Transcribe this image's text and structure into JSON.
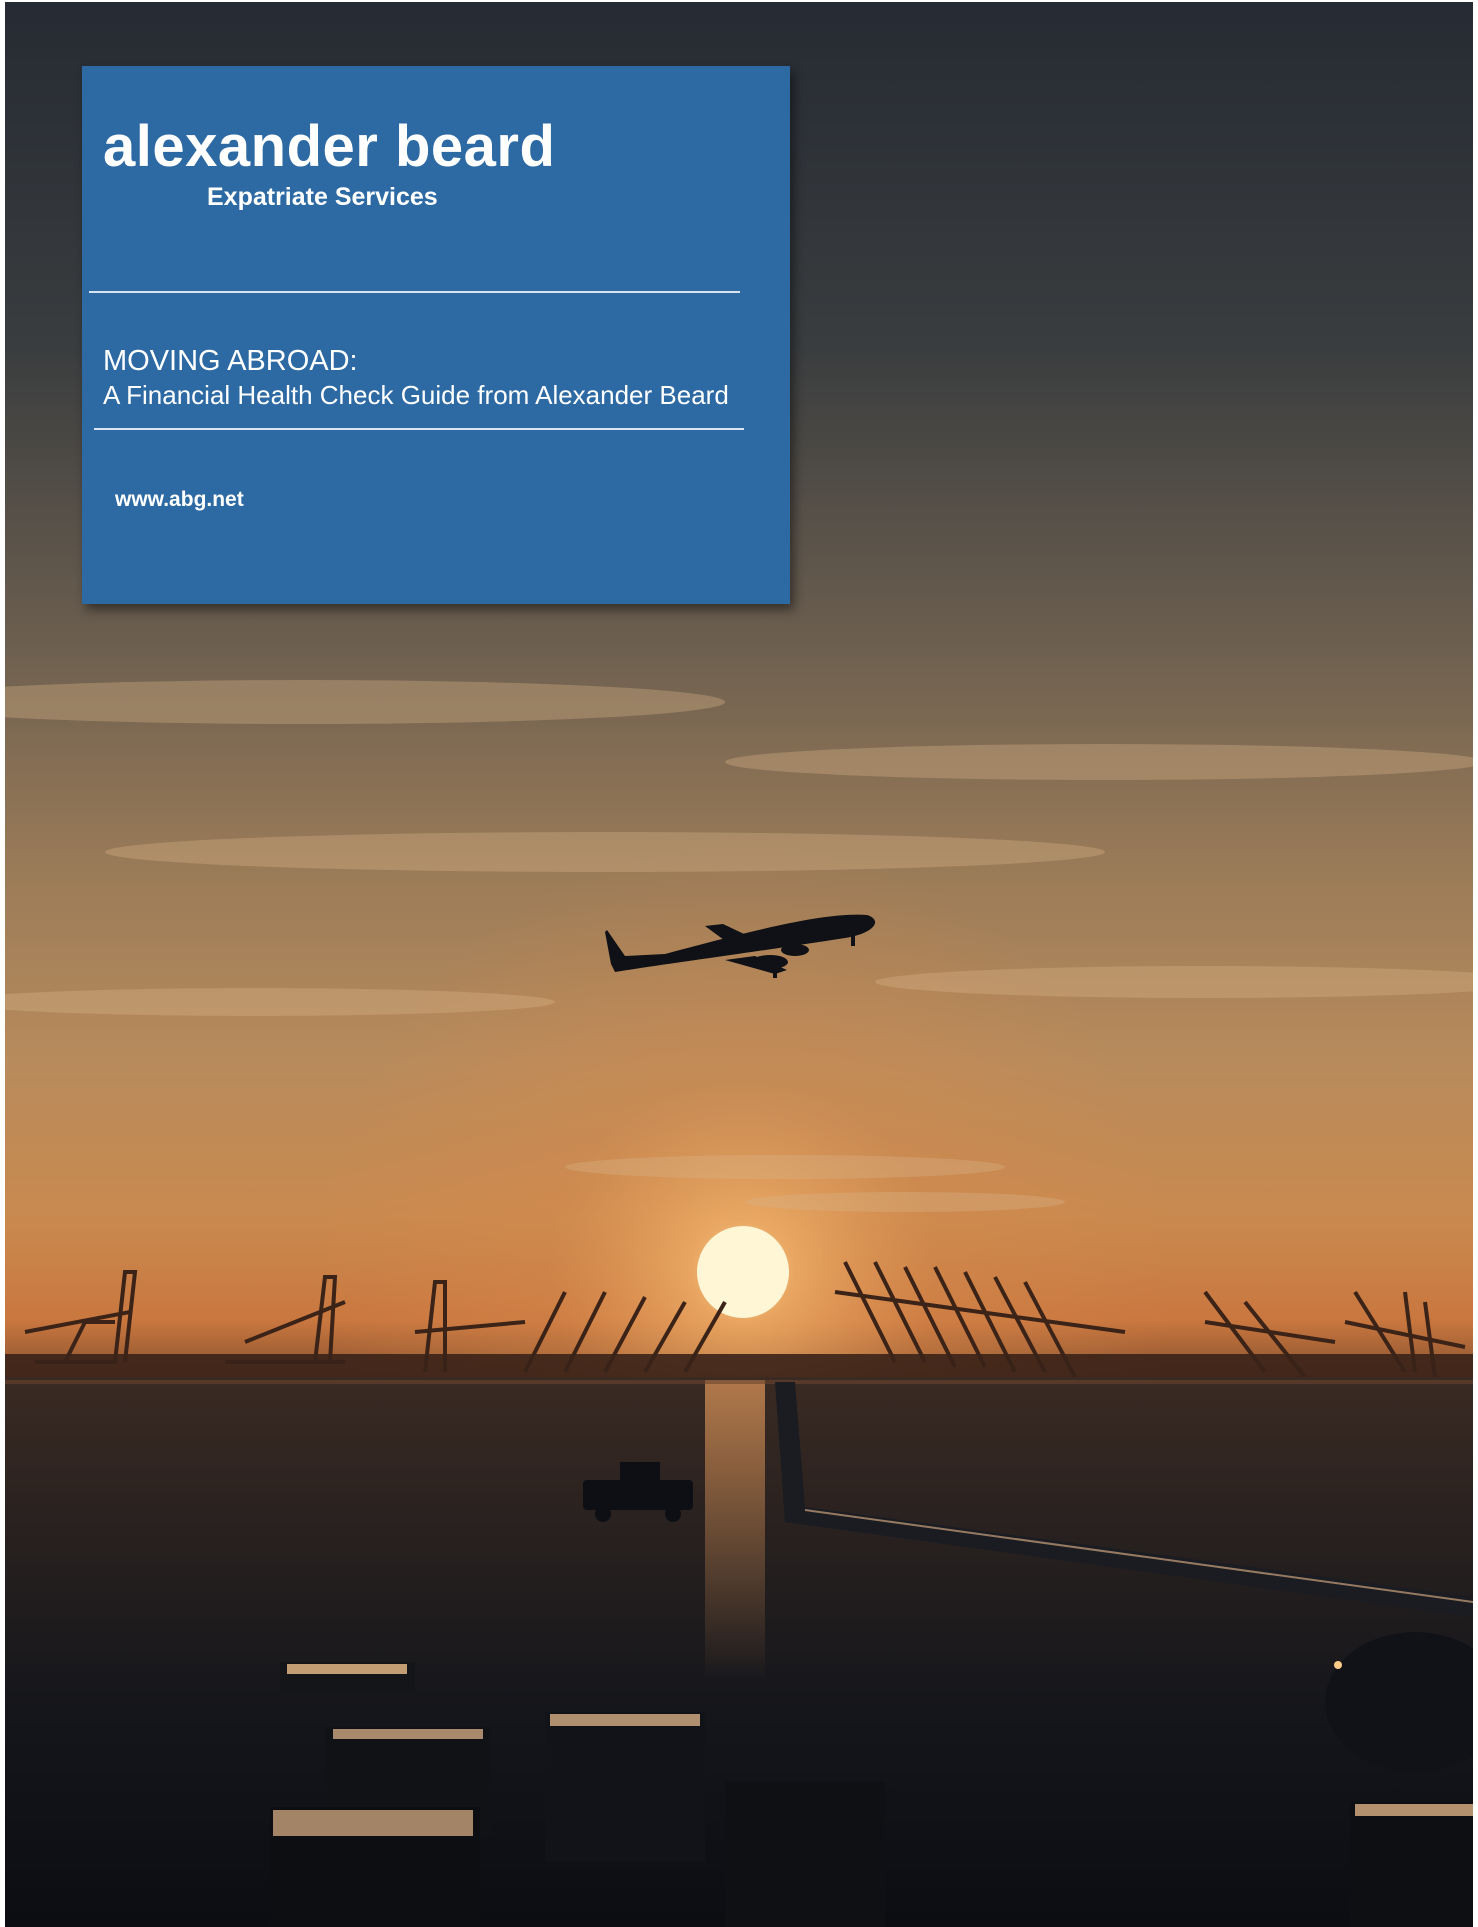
{
  "cover": {
    "brand_name": "alexander beard",
    "brand_tagline": "Expatriate Services",
    "heading": "MOVING ABROAD:",
    "subheading": "A Financial Health Check Guide from Alexander Beard",
    "website": "www.abg.net"
  },
  "background": {
    "scene": "airport-sunset-photo",
    "icons": [
      "airplane-icon",
      "sun-icon",
      "crane-icon",
      "truck-icon"
    ],
    "colors": {
      "sky_top": "#2a2f38",
      "sky_glow": "#c8834a",
      "sun": "#fff4c8",
      "ground": "#0f1218",
      "card": "#2d6aa3"
    }
  }
}
